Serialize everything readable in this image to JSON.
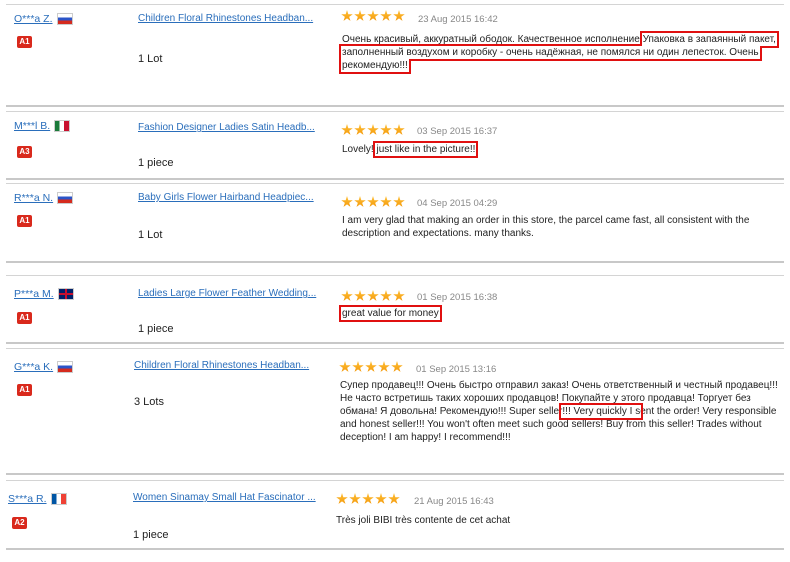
{
  "reviews": [
    {
      "buyer": "O***a Z.",
      "flag": "ru",
      "level": "A1",
      "product": "Children Floral Rhinestones Headban...",
      "quantity": "1 Lot",
      "stars": 5,
      "date": "23 Aug 2015 16:42",
      "comment_pre": "Очень красивый, аккуратный ободок. Качественное исполнение ",
      "comment_highlight": "Упаковка в запаянный пакет, заполненный воздухом и коробку - очень надёжная, не помялся ни один лепесток. Очень рекомендую!!!",
      "comment_post": ""
    },
    {
      "buyer": "M***l B.",
      "flag": "mx",
      "level": "A3",
      "product": "Fashion Designer Ladies Satin Headb...",
      "quantity": "1 piece",
      "stars": 5,
      "date": "03 Sep 2015 16:37",
      "comment_pre": "Lovely! ",
      "comment_highlight": "just like in the picture!!",
      "comment_post": ""
    },
    {
      "buyer": "R***a N.",
      "flag": "ru",
      "level": "A1",
      "product": "Baby Girls Flower Hairband Headpiec...",
      "quantity": "1 Lot",
      "stars": 5,
      "date": "04 Sep 2015 04:29",
      "comment_pre": "I am very glad that making an order in this store, the parcel came fast, all consistent with the description and expectations. many thanks.",
      "comment_highlight": "",
      "comment_post": ""
    },
    {
      "buyer": "P***a M.",
      "flag": "gb",
      "level": "A1",
      "product": "Ladies Large Flower Feather Wedding...",
      "quantity": "1 piece",
      "stars": 5,
      "date": "01 Sep 2015 16:38",
      "comment_pre": "",
      "comment_highlight": "great value for money",
      "comment_post": ""
    },
    {
      "buyer": "G***a K.",
      "flag": "ru",
      "level": "A1",
      "product": "Children Floral Rhinestones Headban...",
      "quantity": "3 Lots",
      "stars": 5,
      "date": "01 Sep 2015 13:16",
      "comment_pre": "Супер продавец!!! Очень быстро отправил заказ! Очень ответственный и честный продавец!!! Не часто встретишь таких хороших продавцов! Покупайте у этого продавца! Торгует без обмана! Я довольна! Рекомендую!!! Super seller",
      "comment_highlight": "!!! Very quickly I s",
      "comment_post": "ent the order! Very responsible and honest seller!!! You won't often meet such good sellers! Buy from this seller! Trades without deception! I am happy! I recommend!!!"
    },
    {
      "buyer": "S***a R.",
      "flag": "fr",
      "level": "A2",
      "product": "Women Sinamay Small Hat Fascinator ...",
      "quantity": "1 piece",
      "stars": 5,
      "date": "21 Aug 2015 16:43",
      "comment_pre": "Très joli BIBI très contente de cet achat",
      "comment_highlight": "",
      "comment_post": ""
    }
  ],
  "colors": {
    "link": "#2a6ebb",
    "badge": "#d9291c",
    "highlight_box": "#e01010",
    "star": "#f5a00a"
  }
}
